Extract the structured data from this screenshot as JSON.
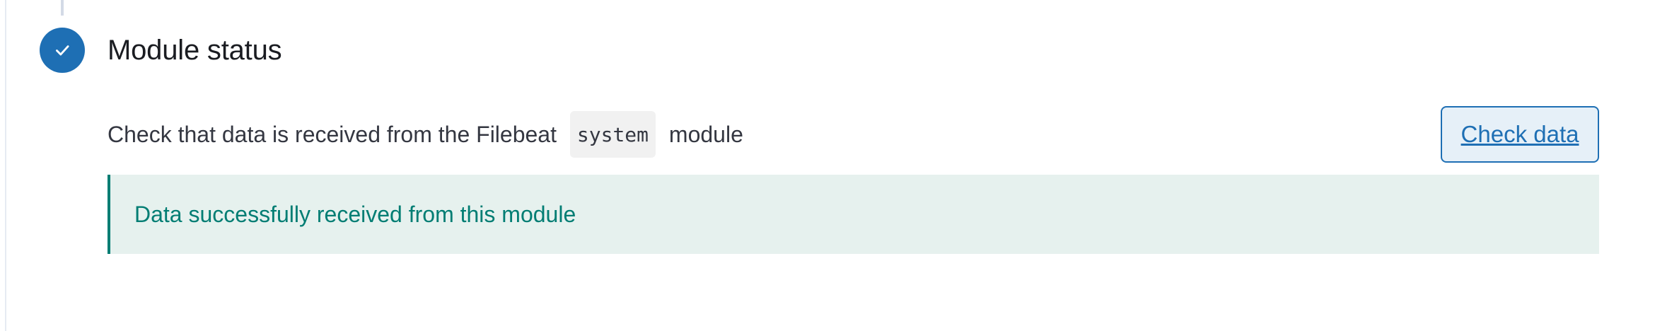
{
  "step": {
    "title": "Module status",
    "status": "complete",
    "indicator_icon": "check-icon",
    "accent_color": "#1e6fb4"
  },
  "description": {
    "before": "Check that data is received from the Filebeat ",
    "code": "system",
    "after": " module"
  },
  "actions": {
    "check_data_label": "Check data"
  },
  "callout": {
    "message": "Data successfully received from this module",
    "color": "#017d73",
    "background": "#e6f1ee"
  }
}
